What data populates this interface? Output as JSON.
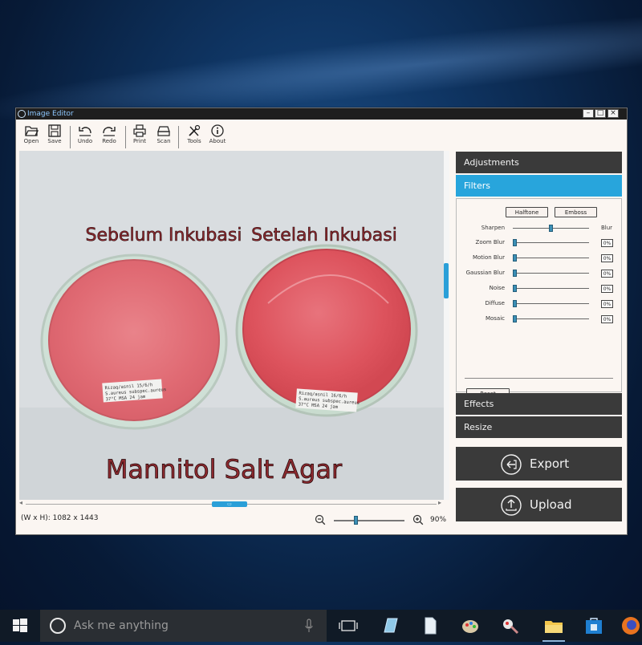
{
  "window": {
    "title": "Image Editor",
    "controls": [
      "minimize-icon",
      "maximize-icon",
      "close-icon"
    ]
  },
  "toolbar": {
    "open": "Open",
    "save": "Save",
    "undo": "Undo",
    "redo": "Redo",
    "print": "Print",
    "scan": "Scan",
    "tools": "Tools",
    "about": "About"
  },
  "photo": {
    "label_left": "Sebelum Inkubasi",
    "label_right": "Setelah Inkubasi",
    "caption": "Mannitol Salt Agar",
    "dish_label_left": [
      "Rizaq/asnil   15/6/h",
      "S.aureus subspec.aureus",
      "37°C   MSA   24 jam"
    ],
    "dish_label_right": [
      "Rizaq/asnil   16/6/h",
      "S.aureus subspec.aureus",
      "37°C   MSA   24 jam"
    ]
  },
  "status": {
    "dimensions": "(W x H): 1082 x 1443",
    "zoom_percent": "90%",
    "zoom_level": 0.3
  },
  "panel": {
    "adjustments": "Adjustments",
    "filters": "Filters",
    "effects": "Effects",
    "resize": "Resize",
    "halftone": "Halftone",
    "emboss": "Emboss",
    "sharpen": "Sharpen",
    "blur": "Blur",
    "sliders": [
      {
        "label": "Zoom Blur",
        "value": "0%"
      },
      {
        "label": "Motion Blur",
        "value": "0%"
      },
      {
        "label": "Gaussian Blur",
        "value": "0%"
      },
      {
        "label": "Noise",
        "value": "0%"
      },
      {
        "label": "Diffuse",
        "value": "0%"
      },
      {
        "label": "Mosaic",
        "value": "0%"
      }
    ],
    "reset": "Reset"
  },
  "actions": {
    "export": "Export",
    "upload": "Upload"
  },
  "taskbar": {
    "search_placeholder": "Ask me anything"
  },
  "colors": {
    "accent": "#28a5dc",
    "panel_dark": "#3a3a3a",
    "label_text": "#8e2a2f",
    "agar": "#e0636b"
  }
}
